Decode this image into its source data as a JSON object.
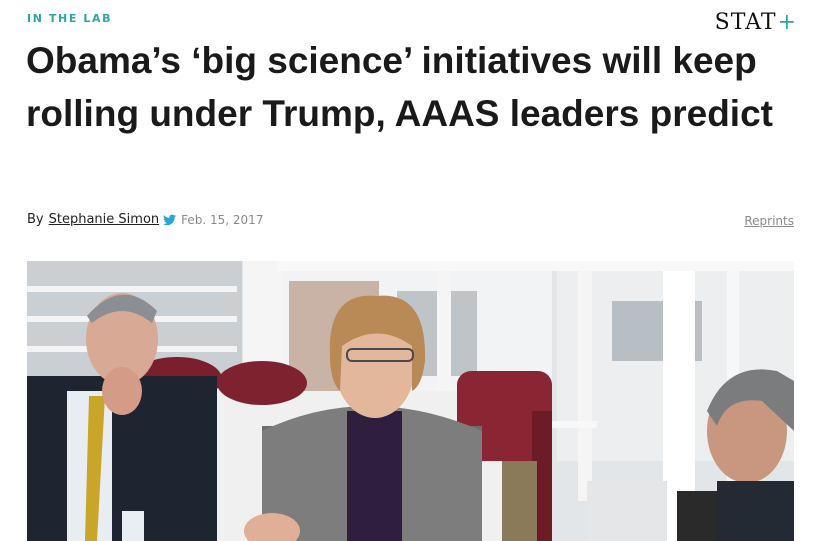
{
  "header": {
    "kicker": "IN THE LAB",
    "brand_text": "STAT",
    "brand_plus": "+",
    "accent_color": "#2aa8a8"
  },
  "article": {
    "headline": "Obama’s ‘big science’ initiatives will keep rolling under Trump, AAAS leaders predict",
    "byline_prefix": "By",
    "author": "Stephanie Simon",
    "author_social_icon": "twitter-icon",
    "date": "Feb. 15, 2017",
    "reprints_label": "Reprints"
  }
}
